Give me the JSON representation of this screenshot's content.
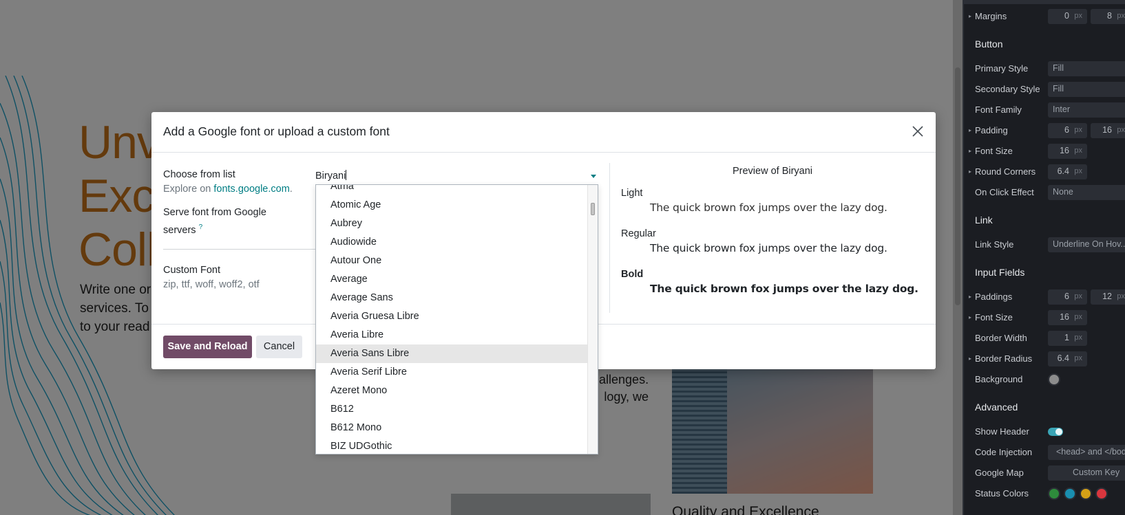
{
  "background": {
    "hero_title_lines": [
      "Unv",
      "Exc",
      "Coll"
    ],
    "hero_text_lines": [
      "Write one or",
      "services. To",
      "to your read"
    ],
    "side_text_lines": [
      "hallenges.",
      "logy, we"
    ],
    "quality_heading": "Quality and Excellence"
  },
  "editor": {
    "rows": [
      {
        "label": "Margins",
        "caret": true,
        "fields": [
          {
            "value": "0",
            "unit": "px"
          },
          {
            "value": "8",
            "unit": "px"
          }
        ]
      },
      {
        "section": "Button"
      },
      {
        "label": "Primary Style",
        "select": "Fill"
      },
      {
        "label": "Secondary Style",
        "select": "Fill"
      },
      {
        "label": "Font Family",
        "select": "Inter"
      },
      {
        "label": "Padding",
        "caret": true,
        "fields": [
          {
            "value": "6",
            "unit": "px"
          },
          {
            "value": "16",
            "unit": "px"
          }
        ]
      },
      {
        "label": "Font Size",
        "caret": true,
        "fields": [
          {
            "value": "16",
            "unit": "px"
          }
        ]
      },
      {
        "label": "Round Corners",
        "caret": true,
        "fields": [
          {
            "value": "6.4",
            "unit": "px"
          }
        ]
      },
      {
        "label": "On Click Effect",
        "select": "None"
      },
      {
        "section": "Link"
      },
      {
        "label": "Link Style",
        "select": "Underline On Hov..."
      },
      {
        "section": "Input Fields"
      },
      {
        "label": "Paddings",
        "caret": true,
        "fields": [
          {
            "value": "6",
            "unit": "px"
          },
          {
            "value": "12",
            "unit": "px"
          }
        ]
      },
      {
        "label": "Font Size",
        "caret": true,
        "fields": [
          {
            "value": "16",
            "unit": "px"
          }
        ]
      },
      {
        "label": "Border Width",
        "fields": [
          {
            "value": "1",
            "unit": "px"
          }
        ]
      },
      {
        "label": "Border Radius",
        "caret": true,
        "fields": [
          {
            "value": "6.4",
            "unit": "px"
          }
        ]
      },
      {
        "label": "Background",
        "color": "#8c8c8c"
      },
      {
        "section": "Advanced"
      },
      {
        "label": "Show Header",
        "toggle": true
      },
      {
        "label": "Code Injection",
        "select": "<head> and </bod"
      },
      {
        "label": "Google Map",
        "select": "Custom Key"
      },
      {
        "label": "Status Colors",
        "swatches": [
          "#2e8b3c",
          "#1a8fb0",
          "#d4a017",
          "#d9363e"
        ]
      }
    ]
  },
  "modal": {
    "title": "Add a Google font or upload a custom font",
    "choose_label": "Choose from list",
    "explore_prefix": "Explore on ",
    "explore_link": "fonts.google.com",
    "explore_suffix": ".",
    "serve_label_line1": "Serve font from Google",
    "serve_label_line2": "servers",
    "serve_help": "?",
    "custom_font_label": "Custom Font",
    "custom_font_types": "zip, ttf, woff, woff2, otf",
    "font_input_value": "Biryani",
    "preview_title": "Preview of Biryani",
    "preview": [
      {
        "weight": "Light",
        "text": "The quick brown fox jumps over the lazy dog."
      },
      {
        "weight": "Regular",
        "text": "The quick brown fox jumps over the lazy dog."
      },
      {
        "weight": "Bold",
        "text": "The quick brown fox jumps over the lazy dog."
      }
    ],
    "save_button": "Save and Reload",
    "cancel_button": "Cancel"
  },
  "dropdown": {
    "options": [
      "Atma",
      "Atomic Age",
      "Aubrey",
      "Audiowide",
      "Autour One",
      "Average",
      "Average Sans",
      "Averia Gruesa Libre",
      "Averia Libre",
      "Averia Sans Libre",
      "Averia Serif Libre",
      "Azeret Mono",
      "B612",
      "B612 Mono",
      "BIZ UDGothic"
    ],
    "highlighted": "Averia Sans Libre"
  }
}
